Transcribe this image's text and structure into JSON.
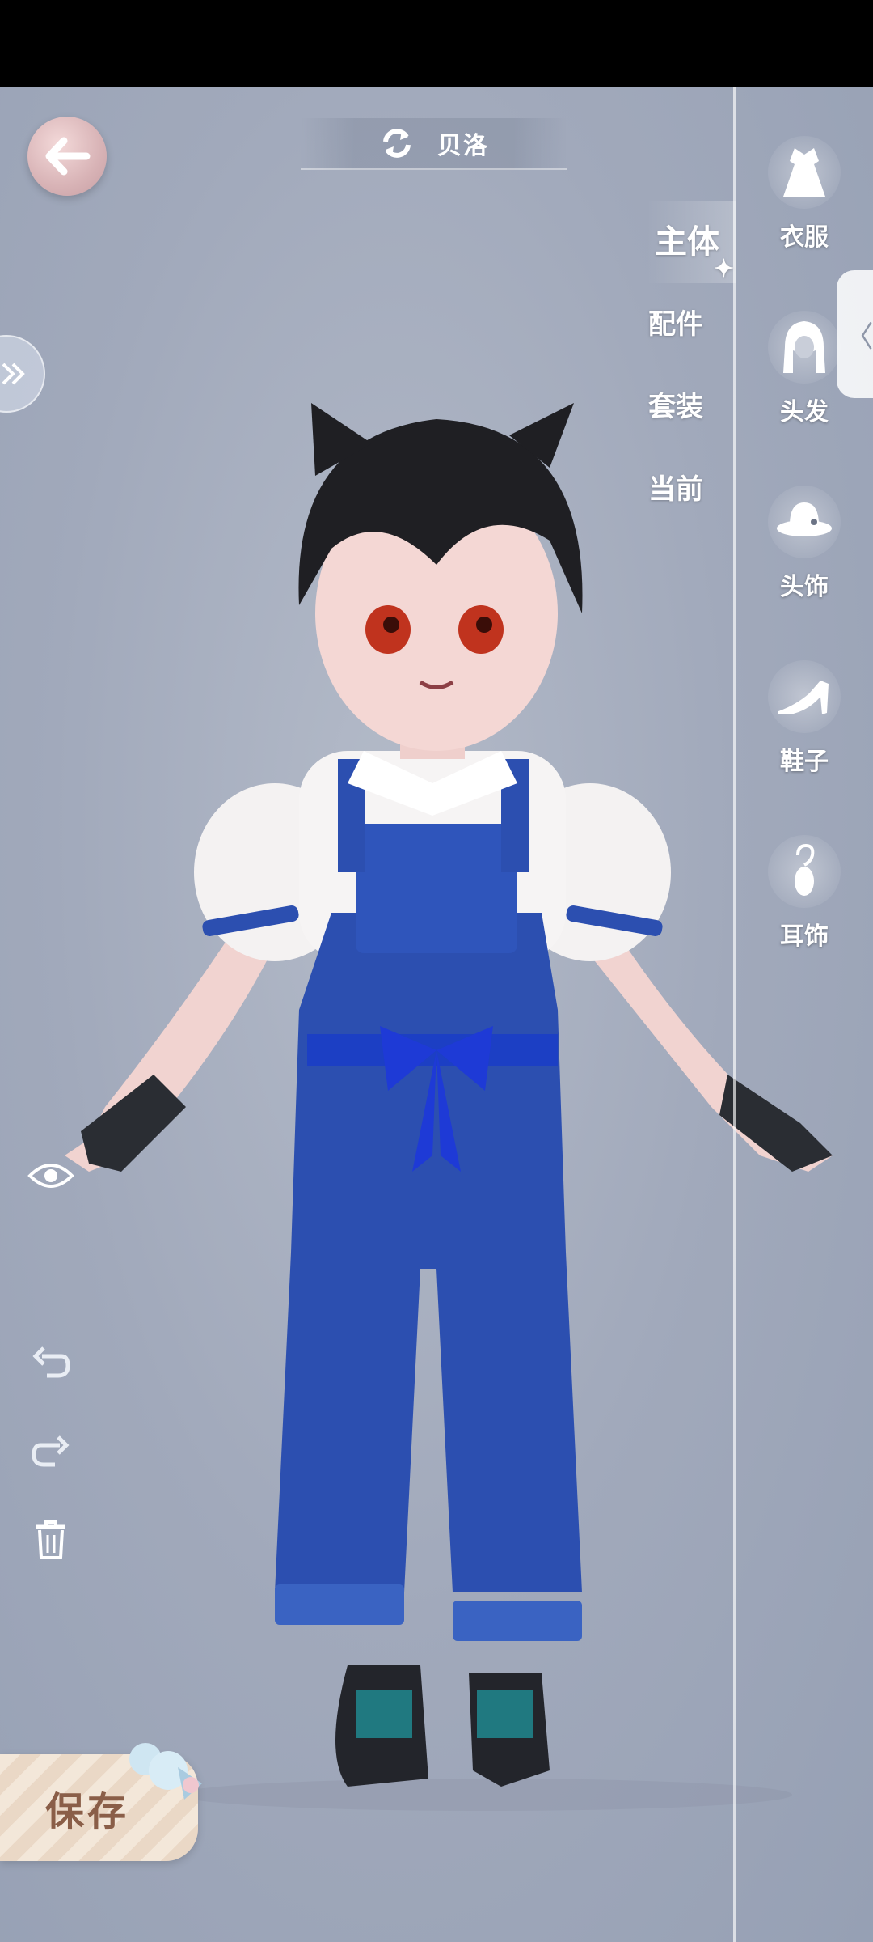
{
  "header": {
    "character_name": "贝洛"
  },
  "category_tabs": [
    {
      "label": "主体",
      "active": true
    },
    {
      "label": "配件",
      "active": false
    },
    {
      "label": "套装",
      "active": false
    },
    {
      "label": "当前",
      "active": false
    }
  ],
  "slots": [
    {
      "label": "衣服",
      "icon": "dress-icon"
    },
    {
      "label": "头发",
      "icon": "hair-icon"
    },
    {
      "label": "头饰",
      "icon": "hat-icon"
    },
    {
      "label": "鞋子",
      "icon": "shoe-icon"
    },
    {
      "label": "耳饰",
      "icon": "earring-icon"
    }
  ],
  "save": {
    "label": "保存"
  },
  "colors": {
    "background": "#a7afc0",
    "overalls": "#2c4fb0",
    "save_text": "#8a5e48"
  }
}
